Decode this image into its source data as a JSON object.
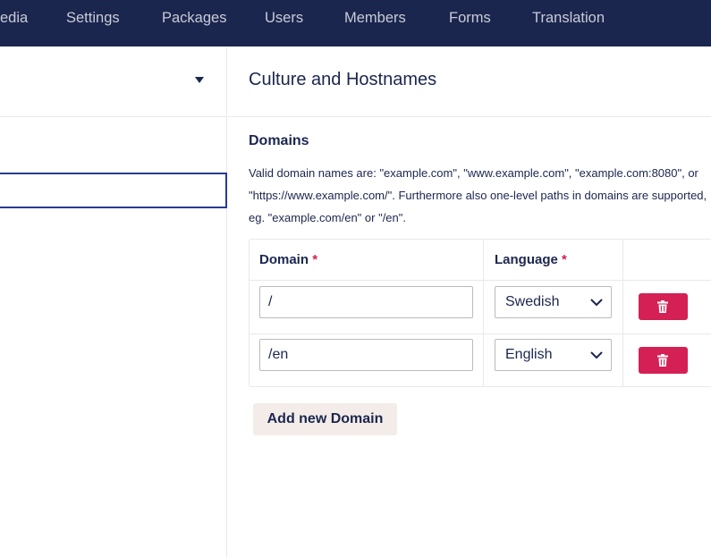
{
  "nav": {
    "items": [
      {
        "id": "media",
        "label": "edia"
      },
      {
        "id": "settings",
        "label": "Settings"
      },
      {
        "id": "packages",
        "label": "Packages"
      },
      {
        "id": "users",
        "label": "Users"
      },
      {
        "id": "members",
        "label": "Members"
      },
      {
        "id": "forms",
        "label": "Forms"
      },
      {
        "id": "translation",
        "label": "Translation"
      }
    ]
  },
  "left_panel": {
    "dropdown_icon": "caret-down-icon",
    "input_value": ""
  },
  "panel": {
    "title": "Culture and Hostnames",
    "section_title": "Domains",
    "help_text": "Valid domain names are: \"example.com\", \"www.example.com\", \"example.com:8080\", or \"https://www.example.com/\". Furthermore also one-level paths in domains are supported, eg. \"example.com/en\" or \"/en\"."
  },
  "table": {
    "col_domain": "Domain",
    "col_language": "Language",
    "required_marker": "*",
    "rows": [
      {
        "domain": "/",
        "language": "Swedish"
      },
      {
        "domain": "/en",
        "language": "English"
      }
    ]
  },
  "add_button_label": "Add new Domain",
  "icons": {
    "delete": "trash-icon",
    "select": "chevron-down-icon"
  },
  "colors": {
    "topbar": "#1b264f",
    "danger": "#d42054",
    "add_button_bg": "#f3ece8",
    "focus_border": "#283a97"
  }
}
